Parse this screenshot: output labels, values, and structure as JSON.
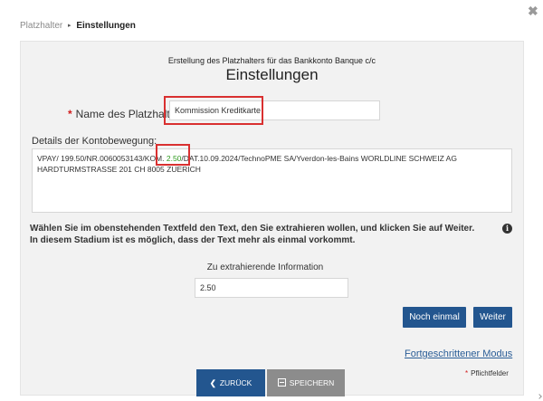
{
  "breadcrumb": {
    "parent": "Platzhalter",
    "current": "Einstellungen"
  },
  "dialog": {
    "subtitle": "Erstellung des Platzhalters für das Bankkonto Banque c/c",
    "title": "Einstellungen"
  },
  "name_field": {
    "label": "Name des Platzhalters",
    "required_marker": "*",
    "value": "Kommission Kreditkarte"
  },
  "details": {
    "label": "Details der Kontobewegung:",
    "text_before": "VPAY/ 199.50/NR.0060053143/KOM. ",
    "text_highlight": "2.50",
    "text_after": "/DAT.10.09.2024/TechnoPME SA/Yverdon-les-Bains WORLDLINE SCHWEIZ AG HARDTURMSTRASSE 201 CH 8005 ZUERICH"
  },
  "instructions": "Wählen Sie im obenstehenden Textfeld den Text, den Sie extrahieren wollen, und klicken Sie auf Weiter. In diesem Stadium ist es möglich, dass der Text mehr als einmal vorkommt.",
  "extract": {
    "label": "Zu extrahierende Information",
    "value": "2.50"
  },
  "buttons": {
    "again": "Noch einmal",
    "next": "Weiter",
    "back": "ZURÜCK",
    "save": "SPEICHERN"
  },
  "advanced_link": "Fortgeschrittener Modus",
  "required_note": {
    "marker": "*",
    "text": "Pflichtfelder"
  },
  "colors": {
    "primary_button": "#23568f",
    "disabled_button": "#8c8c8c",
    "highlight_box": "#d93030",
    "extracted_text": "#2e9a1e",
    "required": "#d11c1c"
  }
}
